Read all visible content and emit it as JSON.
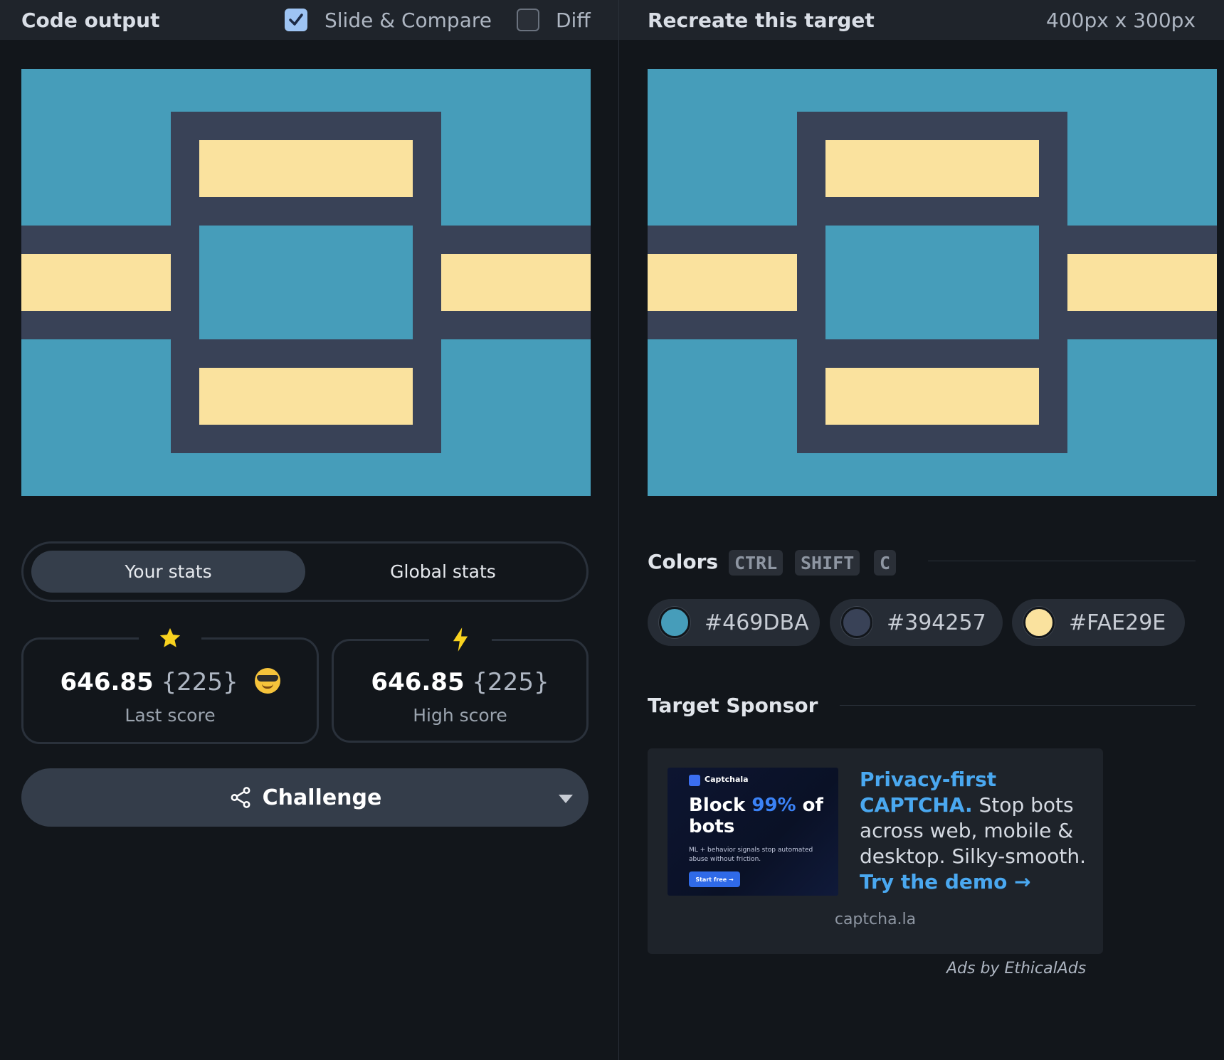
{
  "left": {
    "title": "Code output",
    "slide_compare": {
      "label": "Slide & Compare",
      "checked": true
    },
    "diff": {
      "label": "Diff",
      "checked": false
    },
    "tabs": [
      {
        "label": "Your stats",
        "active": true
      },
      {
        "label": "Global stats",
        "active": false
      }
    ],
    "cards": [
      {
        "score": "646.85",
        "count": "{225}",
        "label": "Last score",
        "icon": "star-icon",
        "emoji": "sunglasses-emoji"
      },
      {
        "score": "646.85",
        "count": "{225}",
        "label": "High score",
        "icon": "lightning-icon"
      }
    ],
    "challenge": {
      "label": "Challenge",
      "icon": "share-icon"
    }
  },
  "right": {
    "title": "Recreate this target",
    "dimensions": "400px x 300px",
    "colors_title": "Colors",
    "shortcut": [
      "CTRL",
      "SHIFT",
      "C"
    ],
    "swatches": [
      {
        "hex": "#469DBA",
        "label": "#469DBA"
      },
      {
        "hex": "#394257",
        "label": "#394257"
      },
      {
        "hex": "#FAE29E",
        "label": "#FAE29E"
      }
    ],
    "sponsor_title": "Target Sponsor",
    "ad": {
      "brand": "Captchala",
      "headline_prefix": "Block ",
      "headline_highlight": "99%",
      "headline_suffix": " of bots",
      "fine_print": "ML + behavior signals stop automated abuse without friction.",
      "cta": "Start free →",
      "copy_highlight": "Privacy-first CAPTCHA.",
      "copy_body": " Stop bots across web, mobile & desktop. Silky-smooth. ",
      "copy_link": "Try the demo →",
      "domain": "captcha.la",
      "credit": "Ads by EthicalAds"
    }
  },
  "colors": {
    "blue": "#469DBA",
    "dark": "#394257",
    "light": "#FAE29E"
  }
}
